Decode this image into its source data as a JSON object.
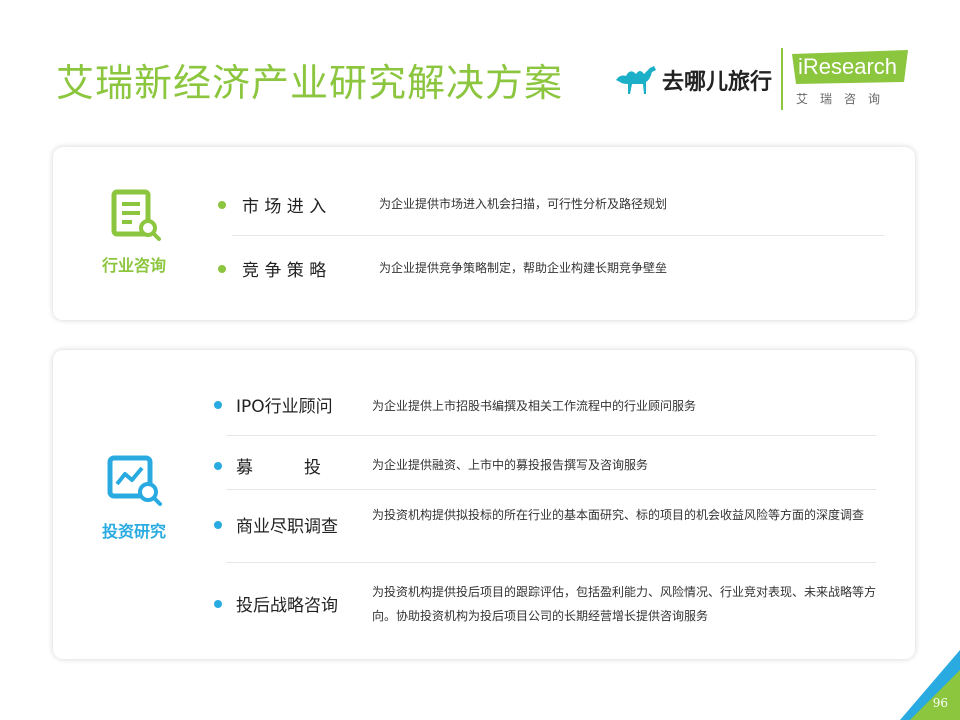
{
  "title": "艾瑞新经济产业研究解决方案",
  "logos": {
    "qunar": "去哪儿旅行",
    "iresearch": "iResearch",
    "iresearch_cn": "艾瑞咨询"
  },
  "colors": {
    "green": "#8cc63f",
    "blue": "#29abe2"
  },
  "sections": [
    {
      "category": "行业咨询",
      "icon": "document-search-icon",
      "items": [
        {
          "name": "市 场 进 入",
          "desc": "为企业提供市场进入机会扫描，可行性分析及路径规划"
        },
        {
          "name": "竞 争 策 略",
          "desc": "为企业提供竞争策略制定，帮助企业构建长期竞争壁垒"
        }
      ]
    },
    {
      "category": "投资研究",
      "icon": "chart-search-icon",
      "items": [
        {
          "name": "IPO行业顾问",
          "desc": "为企业提供上市招股书编撰及相关工作流程中的行业顾问服务"
        },
        {
          "name": "募　　　投",
          "desc": "为企业提供融资、上市中的募投报告撰写及咨询服务"
        },
        {
          "name": "商业尽职调查",
          "desc": "为投资机构提供拟投标的所在行业的基本面研究、标的项目的机会收益风险等方面的深度调查"
        },
        {
          "name": "投后战略咨询",
          "desc": "为投资机构提供投后项目的跟踪评估，包括盈利能力、风险情况、行业竞对表现、未来战略等方向。协助投资机构为投后项目公司的长期经营增长提供咨询服务"
        }
      ]
    }
  ],
  "page_number": "96"
}
